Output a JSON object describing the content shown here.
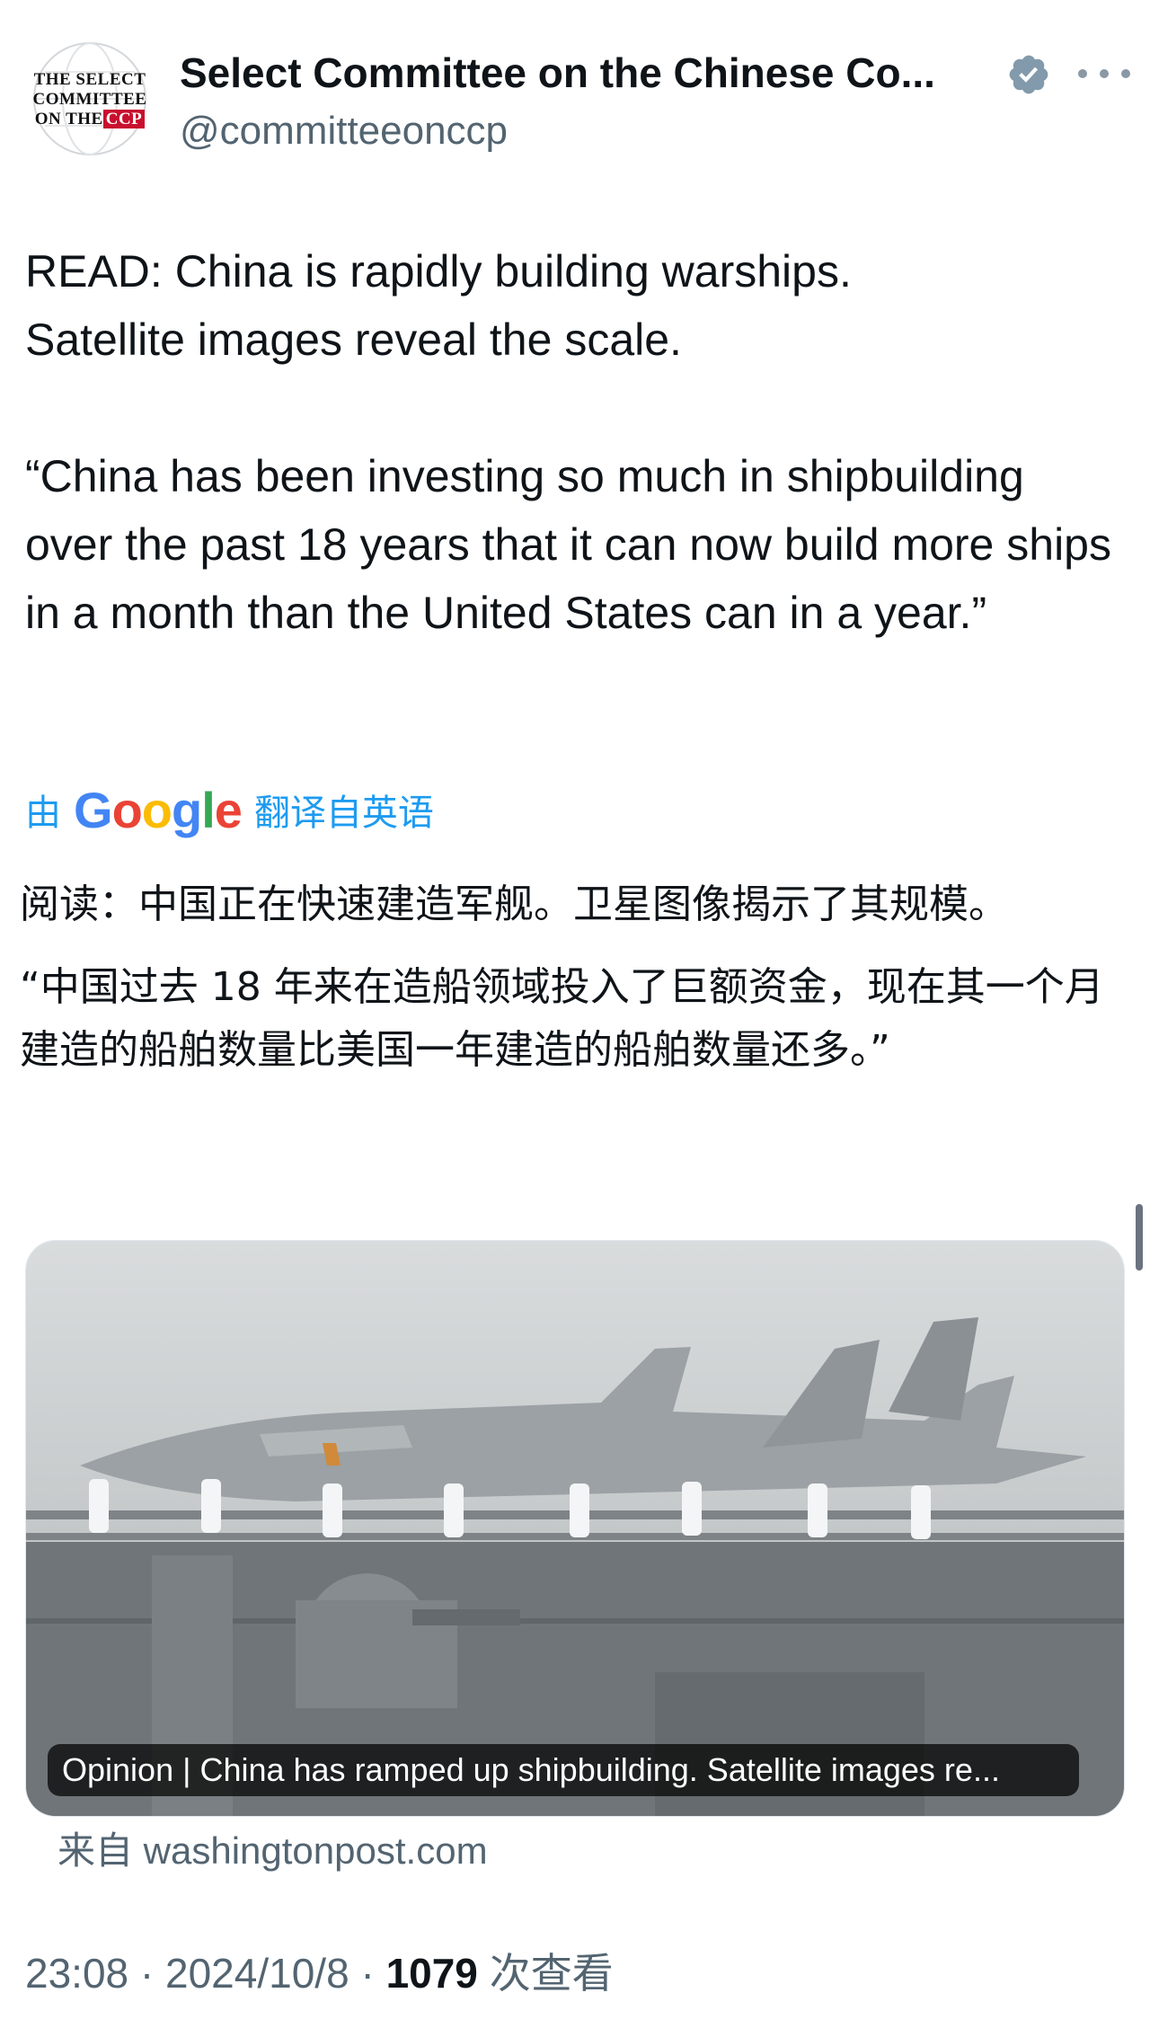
{
  "header": {
    "avatar_logo_line1": "THE SELECT",
    "avatar_logo_line2": "COMMITTEE",
    "avatar_logo_line3": "ON THE",
    "avatar_logo_ccp": "CCP",
    "display_name": "Select Committee on the Chinese Co...",
    "handle": "@committeeonccp",
    "verified_icon": "verified-badge-icon",
    "more_icon": "more-options-icon"
  },
  "tweet": {
    "text": "READ: China is rapidly building warships.\nSatellite images reveal the scale.\n\n“China has been investing so much in shipbuilding over the past 18 years that it can now build more ships in a month than the United States can in a year.”"
  },
  "translation": {
    "prefix": "由",
    "logo": "Google",
    "suffix": "翻译自英语",
    "paragraph1": "阅读：中国正在快速建造军舰。卫星图像揭示了其规模。",
    "paragraph2": "“中国过去 18 年来在造船领域投入了巨额资金，现在其一个月建造的船舶数量比美国一年建造的船舶数量还多。”"
  },
  "card": {
    "caption": "Opinion | China has ramped up shipbuilding. Satellite images re...",
    "source": "来自 washingtonpost.com"
  },
  "meta": {
    "time": "23:08",
    "date": "2024/10/8",
    "views": "1079",
    "views_label": "次查看"
  },
  "colors": {
    "link_blue": "#1d9bf0",
    "verified_gray": "#829aab",
    "secondary_text": "#536471"
  }
}
